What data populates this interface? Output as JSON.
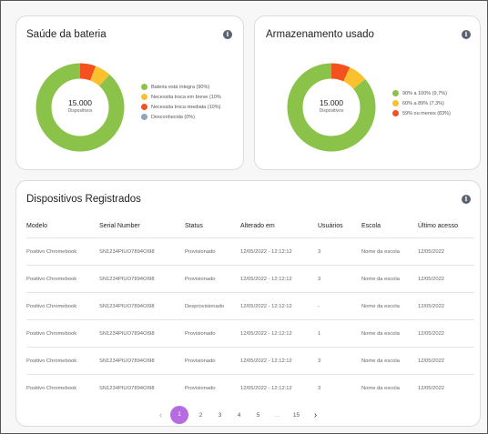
{
  "battery": {
    "title": "Saúde da bateria",
    "total": "15.000",
    "total_label": "Dispositivos",
    "segments": [
      {
        "label": "Bateria está íntegra (90%)",
        "value": 90,
        "color": "#8bc34a"
      },
      {
        "label": "Necessita troca em breve (10%",
        "value": 6,
        "color": "#fbc02d"
      },
      {
        "label": "Necessita troca imediata (10%)",
        "value": 6,
        "color": "#f4511e"
      },
      {
        "label": "Desconhecida (0%)",
        "value": 0,
        "color": "#90a4c0"
      }
    ]
  },
  "storage": {
    "title": "Armazenamento usado",
    "total": "15.000",
    "total_label": "Dispositivos",
    "segments": [
      {
        "label": "90% a 100% (9,7%)",
        "value": 86,
        "color": "#8bc34a"
      },
      {
        "label": "60% a 89% (7,3%)",
        "value": 7,
        "color": "#fbc02d"
      },
      {
        "label": "59% ou menos (83%)",
        "value": 7,
        "color": "#f4511e"
      }
    ]
  },
  "devices": {
    "title": "Dispositivos Registrados",
    "columns": [
      "Modelo",
      "Serial Number",
      "Status",
      "Alterado em",
      "Usuários",
      "Escola",
      "Último acesso"
    ],
    "rows": [
      [
        "Positivo Chromebook",
        "SN1234PIUO7894OI98",
        "Provisionado",
        "12/05/2022 - 12:12:12",
        "3",
        "Nome da escola",
        "12/05/2022"
      ],
      [
        "Positivo Chromebook",
        "SN1234PIUO7894OI98",
        "Provisionado",
        "12/05/2022 - 12:12:12",
        "3",
        "Nome da escola",
        "12/05/2022"
      ],
      [
        "Positivo Chromebook",
        "SN1234PIUO7894OI98",
        "Desprovisionado",
        "12/05/2022 - 12:12:12",
        "-",
        "Nome da escola",
        "12/05/2022"
      ],
      [
        "Positivo Chromebook",
        "SN1234PIUO7894OI98",
        "Provisionado",
        "12/05/2022 - 12:12:12",
        "1",
        "Nome da escola",
        "12/05/2022"
      ],
      [
        "Positivo Chromebook",
        "SN1234PIUO7894OI98",
        "Provisionado",
        "12/05/2022 - 12:12:12",
        "3",
        "Nome da escola",
        "12/05/2022"
      ],
      [
        "Positivo Chromebook",
        "SN1234PIUO7894OI98",
        "Provisionado",
        "12/05/2022 - 12:12:12",
        "3",
        "Nome da escola",
        "12/05/2022"
      ]
    ]
  },
  "pagination": {
    "prev": "‹",
    "pages": [
      "1",
      "2",
      "3",
      "4",
      "5",
      "...",
      "15"
    ],
    "next": "›",
    "current": "1",
    "active_color": "#b76be0"
  },
  "icons": {
    "info": "info-icon",
    "prev": "chevron-left-icon",
    "next": "chevron-right-icon"
  }
}
